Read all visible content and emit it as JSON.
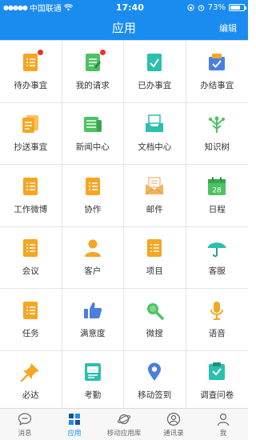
{
  "status_bar": {
    "carrier": "中国联通",
    "time": "17:40",
    "battery": "73%",
    "battery_level": 0.73
  },
  "nav": {
    "title": "应用",
    "edit_label": "编辑"
  },
  "apps": [
    {
      "label": "待办事宜",
      "icon": "todo-icon",
      "badge": true
    },
    {
      "label": "我的请求",
      "icon": "my-request-icon",
      "badge": true
    },
    {
      "label": "已办事宜",
      "icon": "done-icon",
      "badge": false
    },
    {
      "label": "办结事宜",
      "icon": "finished-icon",
      "badge": false
    },
    {
      "label": "抄送事宜",
      "icon": "cc-icon",
      "badge": false
    },
    {
      "label": "新闻中心",
      "icon": "news-icon",
      "badge": false
    },
    {
      "label": "文档中心",
      "icon": "document-icon",
      "badge": false
    },
    {
      "label": "知识树",
      "icon": "knowledge-tree-icon",
      "badge": false
    },
    {
      "label": "工作微博",
      "icon": "work-weibo-icon",
      "badge": false
    },
    {
      "label": "协作",
      "icon": "collaboration-icon",
      "badge": false
    },
    {
      "label": "邮件",
      "icon": "mail-icon",
      "badge": false
    },
    {
      "label": "日程",
      "icon": "calendar-icon",
      "badge": false
    },
    {
      "label": "会议",
      "icon": "meeting-icon",
      "badge": false
    },
    {
      "label": "客户",
      "icon": "customer-icon",
      "badge": false
    },
    {
      "label": "项目",
      "icon": "project-icon",
      "badge": false
    },
    {
      "label": "客服",
      "icon": "umbrella-icon",
      "badge": false
    },
    {
      "label": "任务",
      "icon": "task-icon",
      "badge": false
    },
    {
      "label": "满意度",
      "icon": "thumbs-up-icon",
      "badge": false
    },
    {
      "label": "微搜",
      "icon": "search-icon",
      "badge": false
    },
    {
      "label": "语音",
      "icon": "microphone-icon",
      "badge": false
    },
    {
      "label": "必达",
      "icon": "pin-icon",
      "badge": false
    },
    {
      "label": "考勤",
      "icon": "attendance-icon",
      "badge": false
    },
    {
      "label": "移动签到",
      "icon": "location-icon",
      "badge": false
    },
    {
      "label": "调查问卷",
      "icon": "survey-icon",
      "badge": false
    }
  ],
  "calendar_day": "28",
  "tabs": [
    {
      "label": "消息",
      "icon": "chat-bubble-icon",
      "active": false
    },
    {
      "label": "应用",
      "icon": "apps-grid-icon",
      "active": true
    },
    {
      "label": "移动应用库",
      "icon": "planet-icon",
      "active": false
    },
    {
      "label": "通讯录",
      "icon": "contact-icon",
      "active": false
    },
    {
      "label": "我",
      "icon": "person-icon",
      "active": false
    }
  ],
  "colors": {
    "primary": "#1a8cf0",
    "orange": "#f5a623",
    "green": "#4cc264",
    "teal": "#2bbfae",
    "blue": "#4a7fe0",
    "red_badge": "#e8322a"
  }
}
